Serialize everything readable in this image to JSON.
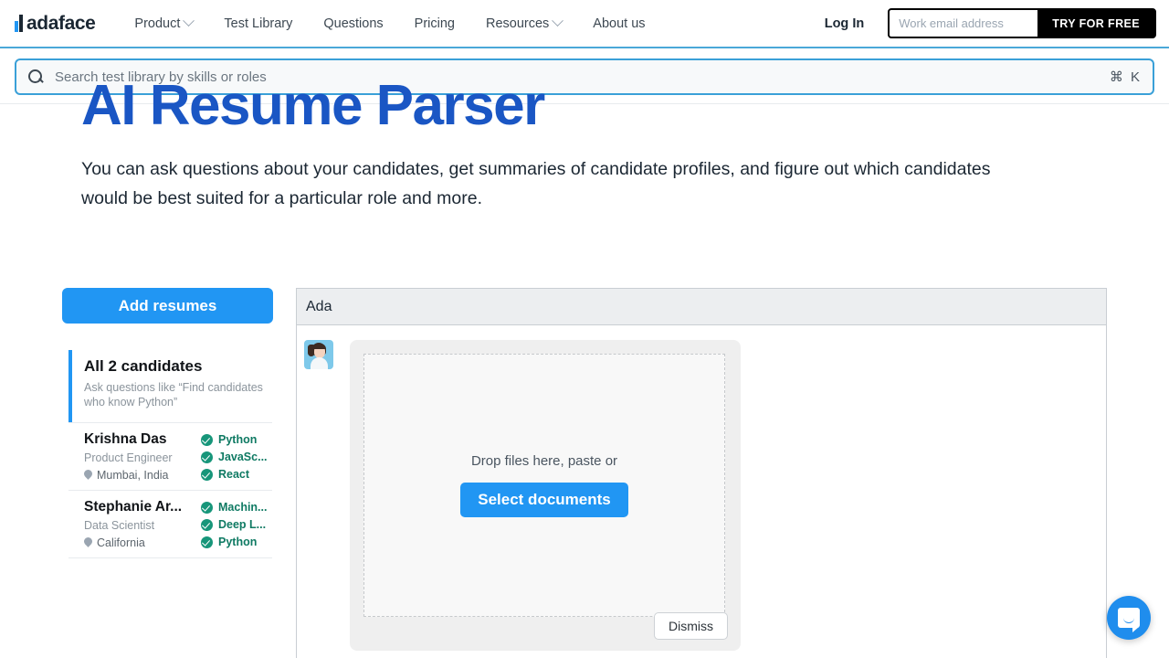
{
  "nav": {
    "logo_text": "adaface",
    "links": [
      {
        "label": "Product",
        "caret": true
      },
      {
        "label": "Test Library",
        "caret": false
      },
      {
        "label": "Questions",
        "caret": false
      },
      {
        "label": "Pricing",
        "caret": false
      },
      {
        "label": "Resources",
        "caret": true
      },
      {
        "label": "About us",
        "caret": false
      }
    ],
    "login_label": "Log In",
    "email_placeholder": "Work email address",
    "email_value": "",
    "try_label": "TRY FOR FREE"
  },
  "search": {
    "placeholder": "Search test library by skills or roles",
    "value": "",
    "shortcut": "⌘ K"
  },
  "hero": {
    "title": "AI Resume Parser",
    "subtitle": "You can ask questions about your candidates, get summaries of candidate profiles, and figure out which candidates would be best suited for a particular role and more."
  },
  "sidebar": {
    "add_resumes_label": "Add resumes",
    "group": {
      "title": "All 2 candidates",
      "subtitle": "Ask questions like “Find candidates who know Python”"
    },
    "candidates": [
      {
        "name": "Krishna Das",
        "role": "Product Engineer",
        "location": "Mumbai, India",
        "skills": [
          "Python",
          "JavaSc...",
          "React"
        ]
      },
      {
        "name": "Stephanie Ar...",
        "role": "Data Scientist",
        "location": "California",
        "skills": [
          "Machin...",
          "Deep L...",
          "Python"
        ]
      }
    ]
  },
  "panel": {
    "title": "Ada",
    "drop_text": "Drop files here, paste or",
    "select_label": "Select documents",
    "dismiss_label": "Dismiss"
  },
  "colors": {
    "accent_blue": "#2196f3",
    "hero_blue": "#1a56c4",
    "skill_green": "#0f7a63",
    "cta_black": "#000000"
  }
}
